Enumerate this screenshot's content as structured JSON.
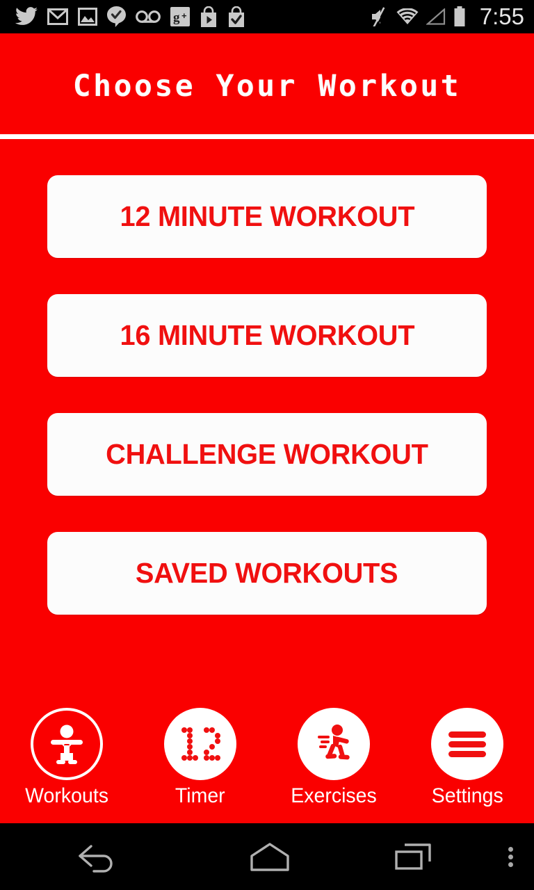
{
  "status_bar": {
    "time": "7:55",
    "left_icons": [
      {
        "name": "twitter-icon"
      },
      {
        "name": "gmail-icon"
      },
      {
        "name": "gallery-icon"
      },
      {
        "name": "hangouts-message-icon"
      },
      {
        "name": "voicemail-icon"
      },
      {
        "name": "google-plus-icon"
      },
      {
        "name": "play-store-download-icon"
      },
      {
        "name": "play-store-installed-icon"
      }
    ],
    "right_icons": [
      {
        "name": "volume-muted-icon"
      },
      {
        "name": "wifi-icon"
      },
      {
        "name": "cellular-signal-icon"
      },
      {
        "name": "battery-icon"
      }
    ]
  },
  "header": {
    "title": "Choose  Your  Workout"
  },
  "main": {
    "buttons": [
      {
        "label": "12 MINUTE WORKOUT"
      },
      {
        "label": "16 MINUTE WORKOUT"
      },
      {
        "label": "CHALLENGE WORKOUT"
      },
      {
        "label": "SAVED WORKOUTS"
      }
    ]
  },
  "bottom_nav": {
    "items": [
      {
        "label": "Workouts",
        "icon": "workouts-figure-icon",
        "selected": true
      },
      {
        "label": "Timer",
        "icon": "timer-12-icon",
        "selected": false
      },
      {
        "label": "Exercises",
        "icon": "running-figure-icon",
        "selected": false
      },
      {
        "label": "Settings",
        "icon": "hamburger-menu-icon",
        "selected": false
      }
    ]
  },
  "android_nav": {
    "back": "back-icon",
    "home": "home-icon",
    "recents": "recents-icon",
    "menu": "overflow-menu-icon"
  },
  "colors": {
    "background_red": "#FA0000",
    "button_white": "#FCFCFC",
    "text_red": "#F01010",
    "status_bar_black": "#000000"
  }
}
